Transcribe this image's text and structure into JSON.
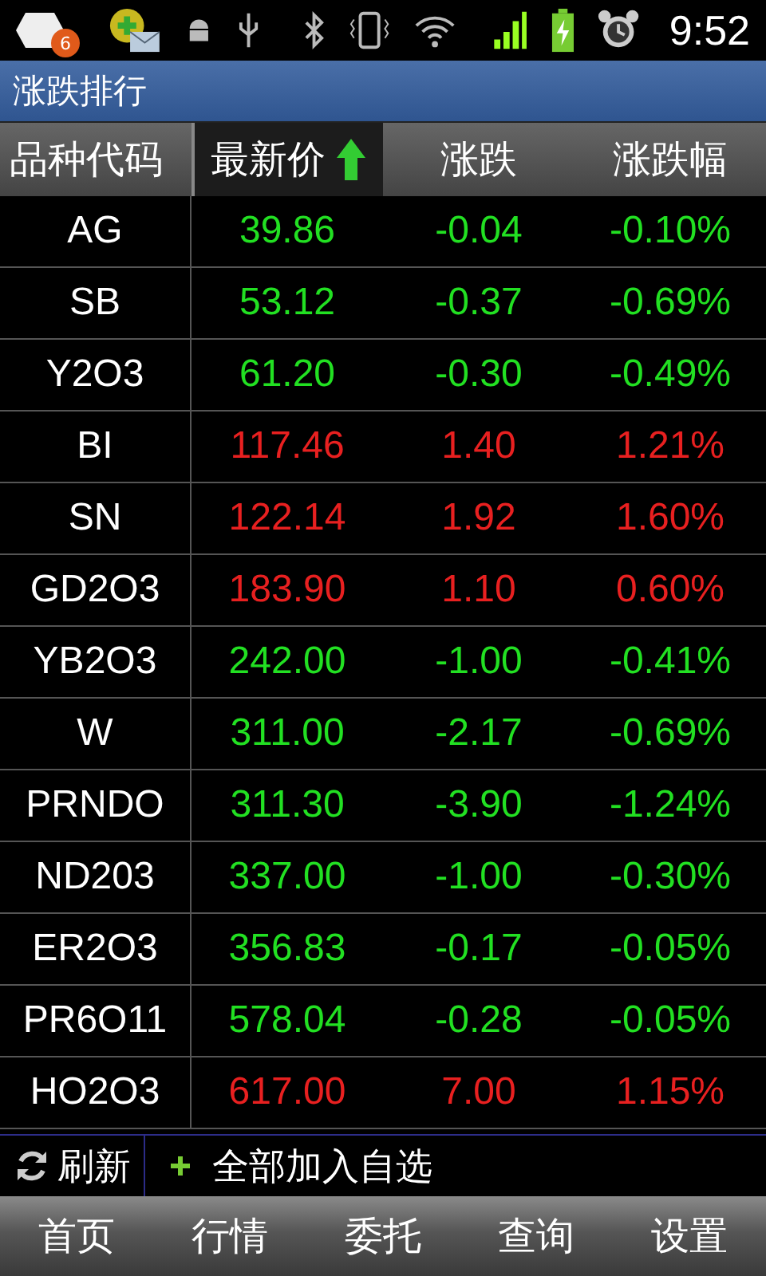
{
  "status_bar": {
    "badge": "6",
    "time": "9:52"
  },
  "title": "涨跌排行",
  "columns": [
    {
      "label": "品种代码",
      "selected": false
    },
    {
      "label": "最新价",
      "selected": true
    },
    {
      "label": "涨跌",
      "selected": false
    },
    {
      "label": "涨跌幅",
      "selected": false
    }
  ],
  "rows": [
    {
      "code": "AG",
      "price": "39.86",
      "change": "-0.04",
      "percent": "-0.10%",
      "kind": "down"
    },
    {
      "code": "SB",
      "price": "53.12",
      "change": "-0.37",
      "percent": "-0.69%",
      "kind": "down"
    },
    {
      "code": "Y2O3",
      "price": "61.20",
      "change": "-0.30",
      "percent": "-0.49%",
      "kind": "down"
    },
    {
      "code": "BI",
      "price": "117.46",
      "change": "1.40",
      "percent": "1.21%",
      "kind": "up"
    },
    {
      "code": "SN",
      "price": "122.14",
      "change": "1.92",
      "percent": "1.60%",
      "kind": "up"
    },
    {
      "code": "GD2O3",
      "price": "183.90",
      "change": "1.10",
      "percent": "0.60%",
      "kind": "up"
    },
    {
      "code": "YB2O3",
      "price": "242.00",
      "change": "-1.00",
      "percent": "-0.41%",
      "kind": "down"
    },
    {
      "code": "W",
      "price": "311.00",
      "change": "-2.17",
      "percent": "-0.69%",
      "kind": "down"
    },
    {
      "code": "PRNDO",
      "price": "311.30",
      "change": "-3.90",
      "percent": "-1.24%",
      "kind": "down"
    },
    {
      "code": "ND203",
      "price": "337.00",
      "change": "-1.00",
      "percent": "-0.30%",
      "kind": "down"
    },
    {
      "code": "ER2O3",
      "price": "356.83",
      "change": "-0.17",
      "percent": "-0.05%",
      "kind": "down"
    },
    {
      "code": "PR6O11",
      "price": "578.04",
      "change": "-0.28",
      "percent": "-0.05%",
      "kind": "down"
    },
    {
      "code": "HO2O3",
      "price": "617.00",
      "change": "7.00",
      "percent": "1.15%",
      "kind": "up"
    }
  ],
  "toolbar": {
    "refresh": "刷新",
    "add_all": "全部加入自选"
  },
  "nav": [
    {
      "label": "首页"
    },
    {
      "label": "行情"
    },
    {
      "label": "委托"
    },
    {
      "label": "查询"
    },
    {
      "label": "设置"
    }
  ]
}
